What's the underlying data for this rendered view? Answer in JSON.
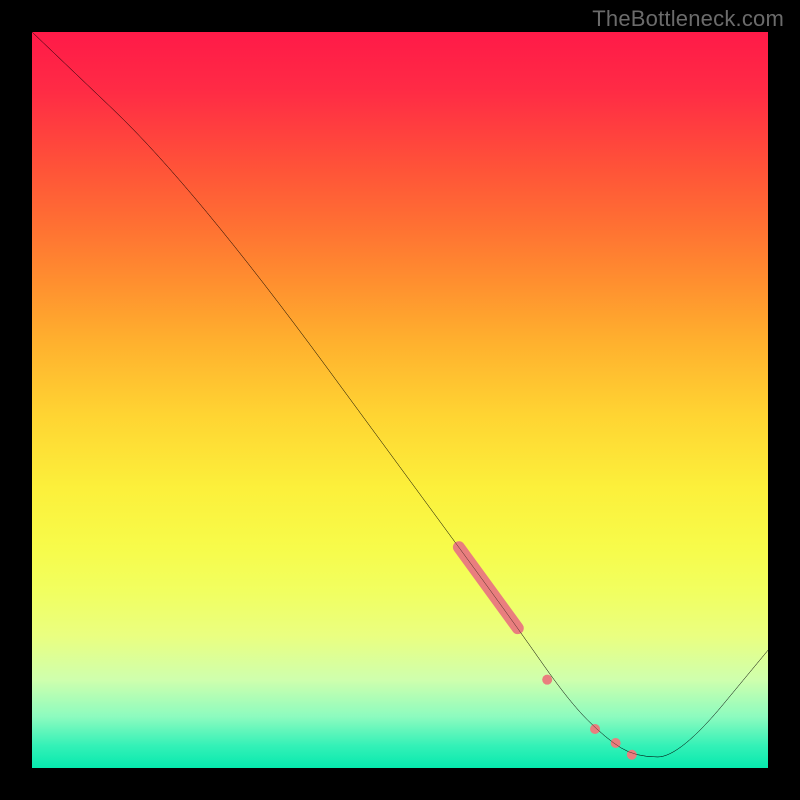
{
  "watermark": "TheBottleneck.com",
  "chart_data": {
    "type": "line",
    "title": "",
    "xlabel": "",
    "ylabel": "",
    "xlim": [
      0,
      100
    ],
    "ylim": [
      0,
      100
    ],
    "series": [
      {
        "name": "curve",
        "color": "#000000",
        "points": [
          {
            "x": 0,
            "y": 100
          },
          {
            "x": 22,
            "y": 79
          },
          {
            "x": 58,
            "y": 30
          },
          {
            "x": 66,
            "y": 19
          },
          {
            "x": 73,
            "y": 9
          },
          {
            "x": 78,
            "y": 4
          },
          {
            "x": 82,
            "y": 1.5
          },
          {
            "x": 88,
            "y": 1.5
          },
          {
            "x": 100,
            "y": 16
          }
        ]
      }
    ],
    "markers": [
      {
        "type": "segment",
        "x1": 58,
        "y1": 30,
        "x2": 66,
        "y2": 19,
        "color": "#e97e7e",
        "width": 12
      },
      {
        "type": "dot",
        "x": 70,
        "y": 12,
        "r": 5,
        "color": "#e97e7e"
      },
      {
        "type": "dot",
        "x": 76.5,
        "y": 5.3,
        "r": 5,
        "color": "#e97e7e"
      },
      {
        "type": "dot",
        "x": 79.3,
        "y": 3.4,
        "r": 5,
        "color": "#e97e7e"
      },
      {
        "type": "dot",
        "x": 81.5,
        "y": 1.8,
        "r": 5,
        "color": "#e97e7e"
      }
    ],
    "annotations": []
  }
}
